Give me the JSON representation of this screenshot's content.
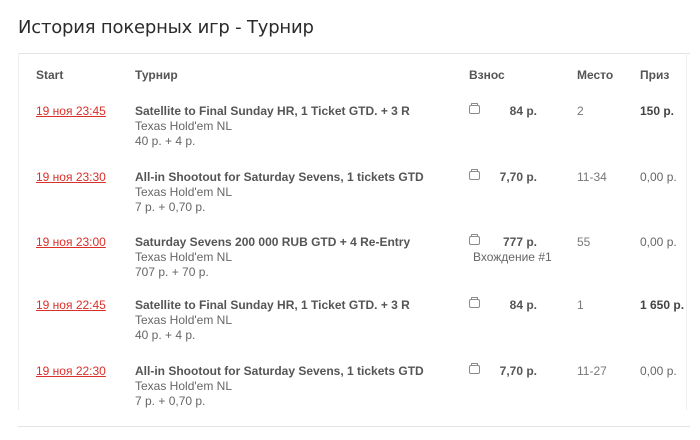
{
  "page": {
    "title": "История покерных игр - Турнир"
  },
  "table": {
    "headers": {
      "start": "Start",
      "tournament": "Турнир",
      "fee": "Взнос",
      "place": "Место",
      "prize": "Приз"
    },
    "rows": [
      {
        "date": "19 ноя 23:45",
        "name": "Satellite to Final Sunday HR, 1 Ticket GTD. + 3 R",
        "game": "Texas Hold'em NL",
        "buyin": "40 р. + 4 р.",
        "fee_icon": "wallet-icon",
        "fee": "84 р.",
        "entry": "",
        "place": "2",
        "prize": "150 р.",
        "prize_won": true
      },
      {
        "date": "19 ноя 23:30",
        "name": "All-in Shootout for Saturday Sevens, 1 tickets GTD",
        "game": "Texas Hold'em NL",
        "buyin": "7 р. + 0,70 р.",
        "fee_icon": "wallet-icon",
        "fee": "7,70 р.",
        "entry": "",
        "place": "11-34",
        "prize": "0,00 р.",
        "prize_won": false
      },
      {
        "date": "19 ноя 23:00",
        "name": "Saturday Sevens 200 000 RUB GTD + 4 Re-Entry",
        "game": "Texas Hold'em NL",
        "buyin": "707 р. + 70 р.",
        "fee_icon": "wallet-icon",
        "fee": "777 р.",
        "entry": "Вхождение #1",
        "place": "55",
        "prize": "0,00 р.",
        "prize_won": false
      },
      {
        "date": "19 ноя 22:45",
        "name": "Satellite to Final Sunday HR, 1 Ticket GTD. + 3 R",
        "game": "Texas Hold'em NL",
        "buyin": "40 р. + 4 р.",
        "fee_icon": "wallet-icon",
        "fee": "84 р.",
        "entry": "",
        "place": "1",
        "prize": "1 650 р.",
        "prize_won": true
      },
      {
        "date": "19 ноя 22:30",
        "name": "All-in Shootout for Saturday Sevens, 1 tickets GTD",
        "game": "Texas Hold'em NL",
        "buyin": "7 р. + 0,70 р.",
        "fee_icon": "wallet-icon",
        "fee": "7,70 р.",
        "entry": "",
        "place": "11-27",
        "prize": "0,00 р.",
        "prize_won": false
      }
    ]
  },
  "colors": {
    "date_link": "#d9302a",
    "text": "#555555",
    "divider": "#e3e3e3"
  }
}
